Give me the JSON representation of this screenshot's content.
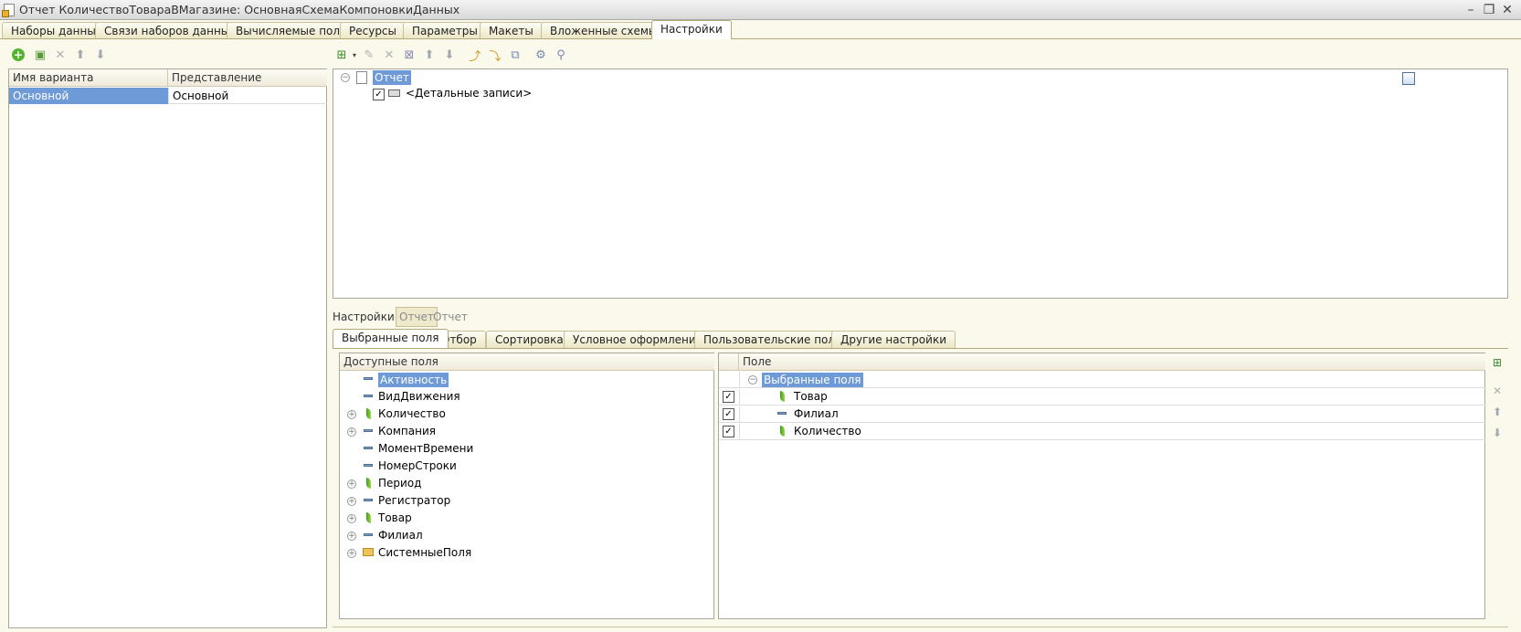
{
  "window": {
    "title": "Отчет КоличествоТовараВМагазине: ОсновнаяСхемаКомпоновкиДанных"
  },
  "tabs": [
    "Наборы данных",
    "Связи наборов данных",
    "Вычисляемые поля",
    "Ресурсы",
    "Параметры",
    "Макеты",
    "Вложенные схемы",
    "Настройки"
  ],
  "active_tab": "Настройки",
  "variants": {
    "headers": [
      "Имя варианта",
      "Представление"
    ],
    "rows": [
      {
        "name": "Основной",
        "presentation": "Основной"
      }
    ]
  },
  "structure": {
    "root": "Отчет",
    "child": "<Детальные записи>"
  },
  "settings_label": "Настройки:",
  "settings_buttons": [
    "Отчет",
    "Отчет"
  ],
  "subtabs": [
    "Выбранные поля",
    "Отбор",
    "Сортировка",
    "Условное оформление",
    "Пользовательские поля",
    "Другие настройки"
  ],
  "available": {
    "header": "Доступные поля",
    "items": [
      {
        "label": "Активность",
        "icon": "dimension-icon",
        "expand": false
      },
      {
        "label": "ВидДвижения",
        "icon": "dimension-icon",
        "expand": false
      },
      {
        "label": "Количество",
        "icon": "resource-icon",
        "expand": true
      },
      {
        "label": "Компания",
        "icon": "dimension-icon",
        "expand": true
      },
      {
        "label": "МоментВремени",
        "icon": "dimension-icon",
        "expand": false
      },
      {
        "label": "НомерСтроки",
        "icon": "dimension-icon",
        "expand": false
      },
      {
        "label": "Период",
        "icon": "resource-icon",
        "expand": true
      },
      {
        "label": "Регистратор",
        "icon": "dimension-icon",
        "expand": true
      },
      {
        "label": "Товар",
        "icon": "resource-icon",
        "expand": true
      },
      {
        "label": "Филиал",
        "icon": "dimension-icon",
        "expand": true
      },
      {
        "label": "СистемныеПоля",
        "icon": "folder-icon",
        "expand": true
      }
    ]
  },
  "selected": {
    "header": "Поле",
    "group": "Выбранные поля",
    "items": [
      {
        "label": "Товар",
        "icon": "resource-icon",
        "checked": true
      },
      {
        "label": "Филиал",
        "icon": "dimension-icon",
        "checked": true
      },
      {
        "label": "Количество",
        "icon": "resource-icon",
        "checked": true
      }
    ]
  }
}
